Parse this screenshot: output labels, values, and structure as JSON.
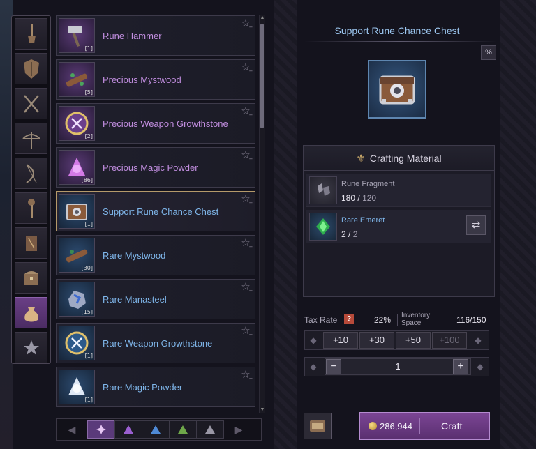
{
  "category_rail": {
    "items": [
      {
        "icon": "shovel-icon",
        "active": false
      },
      {
        "icon": "shield-icon",
        "active": false
      },
      {
        "icon": "crossed-swords-icon",
        "active": false
      },
      {
        "icon": "crossbow-icon",
        "active": false
      },
      {
        "icon": "bow-icon",
        "active": false
      },
      {
        "icon": "staff-icon",
        "active": false
      },
      {
        "icon": "book-icon",
        "active": false
      },
      {
        "icon": "chest-icon",
        "active": false
      },
      {
        "icon": "pouch-icon",
        "active": true
      },
      {
        "icon": "star-icon",
        "active": false
      }
    ]
  },
  "item_list": [
    {
      "name": "Rune Hammer",
      "qty": "[1]",
      "grade": "epic",
      "icon": "hammer-icon",
      "selected": false
    },
    {
      "name": "Precious Mystwood",
      "qty": "[5]",
      "grade": "epic",
      "icon": "wood-icon",
      "selected": false
    },
    {
      "name": "Precious Weapon Growthstone",
      "qty": "[2]",
      "grade": "epic",
      "icon": "growthstone-icon",
      "selected": false
    },
    {
      "name": "Precious Magic Powder",
      "qty": "[86]",
      "grade": "epic",
      "icon": "powder-icon",
      "selected": false
    },
    {
      "name": "Support Rune Chance Chest",
      "qty": "[1]",
      "grade": "blue",
      "icon": "chest-icon",
      "selected": true
    },
    {
      "name": "Rare Mystwood",
      "qty": "[30]",
      "grade": "blue",
      "icon": "wood-icon",
      "selected": false
    },
    {
      "name": "Rare Manasteel",
      "qty": "[15]",
      "grade": "blue",
      "icon": "ore-icon",
      "selected": false
    },
    {
      "name": "Rare Weapon Growthstone",
      "qty": "[1]",
      "grade": "blue",
      "icon": "growthstone-icon",
      "selected": false
    },
    {
      "name": "Rare Magic Powder",
      "qty": "[1]",
      "grade": "blue",
      "icon": "powder-icon",
      "selected": false
    }
  ],
  "grade_tabs": [
    {
      "icon": "all-grades-icon",
      "color": "#e7c8f5",
      "active": true
    },
    {
      "icon": "grade-purple-icon",
      "color": "#9a5fd0",
      "active": false
    },
    {
      "icon": "grade-blue-icon",
      "color": "#4f8ad6",
      "active": false
    },
    {
      "icon": "grade-green-icon",
      "color": "#6fa84a",
      "active": false
    },
    {
      "icon": "grade-gray-icon",
      "color": "#9a98a6",
      "active": false
    }
  ],
  "detail": {
    "title": "Support Rune Chance Chest",
    "percent_button": "%",
    "crafting_header": "Crafting Material",
    "materials": [
      {
        "name": "Rune Fragment",
        "have": "180",
        "need": "120",
        "grade": "gray",
        "icon": "rune-fragment-icon"
      },
      {
        "name": "Rare Emeret",
        "have": "2",
        "need": "2",
        "grade": "blue",
        "icon": "emeret-icon"
      }
    ],
    "slash": "/",
    "swap_icon": "⇄"
  },
  "tax": {
    "label": "Tax Rate",
    "help": "?",
    "rate": "22%",
    "inventory_label": "Inventory Space",
    "inventory_value": "116/150"
  },
  "quantity_buttons": [
    "+10",
    "+30",
    "+50",
    "+100"
  ],
  "quantity": {
    "minus": "−",
    "value": "1",
    "plus": "+"
  },
  "craft": {
    "cost": "286,944",
    "label": "Craft"
  },
  "colors": {
    "epic": "#c28ee0",
    "rare": "#7fb6ea",
    "accent": "#7b4594",
    "title": "#9cc6ef"
  }
}
